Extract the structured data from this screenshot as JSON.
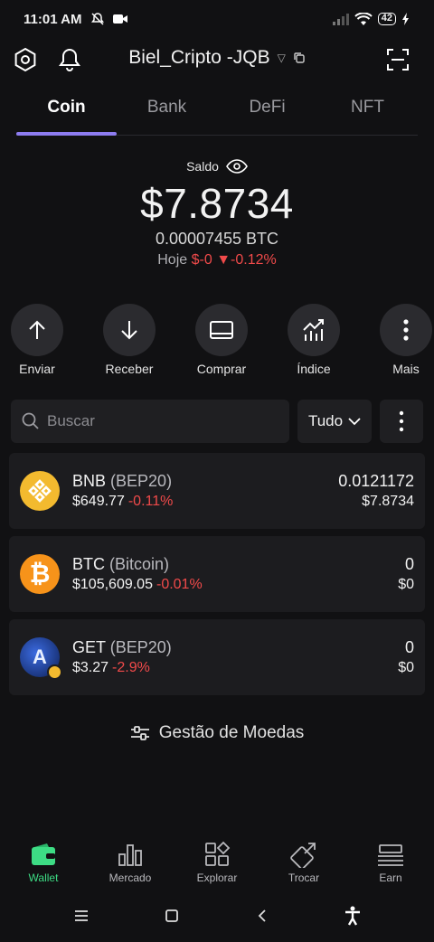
{
  "status_bar": {
    "time": "11:01 AM",
    "battery": "42"
  },
  "header": {
    "wallet_name": "Biel_Cripto -JQB"
  },
  "tabs": [
    {
      "label": "Coin",
      "active": true
    },
    {
      "label": "Bank",
      "active": false
    },
    {
      "label": "DeFi",
      "active": false
    },
    {
      "label": "NFT",
      "active": false
    }
  ],
  "balance": {
    "label": "Saldo",
    "value": "$7.8734",
    "btc": "0.00007455 BTC",
    "today_label": "Hoje",
    "today_change": "$-0",
    "today_percent": "-0.12%"
  },
  "actions": [
    {
      "label": "Enviar",
      "icon": "arrow-up-icon"
    },
    {
      "label": "Receber",
      "icon": "arrow-down-icon"
    },
    {
      "label": "Comprar",
      "icon": "card-icon"
    },
    {
      "label": "Índice",
      "icon": "chart-icon"
    },
    {
      "label": "Mais",
      "icon": "more-vertical-icon"
    }
  ],
  "search": {
    "placeholder": "Buscar",
    "filter_label": "Tudo"
  },
  "coins": [
    {
      "symbol": "BNB",
      "network": "(BEP20)",
      "price": "$649.77",
      "change": "-0.11%",
      "amount": "0.0121172",
      "fiat": "$7.8734",
      "color": "#F3BA2F"
    },
    {
      "symbol": "BTC",
      "network": "(Bitcoin)",
      "price": "$105,609.05",
      "change": "-0.01%",
      "amount": "0",
      "fiat": "$0",
      "color": "#F7931A"
    },
    {
      "symbol": "GET",
      "network": "(BEP20)",
      "price": "$3.27",
      "change": "-2.9%",
      "amount": "0",
      "fiat": "$0",
      "color": "#1b3a8f"
    }
  ],
  "manage_label": "Gestão de Moedas",
  "bottom_nav": [
    {
      "label": "Wallet",
      "active": true
    },
    {
      "label": "Mercado",
      "active": false
    },
    {
      "label": "Explorar",
      "active": false
    },
    {
      "label": "Trocar",
      "active": false
    },
    {
      "label": "Earn",
      "active": false
    }
  ],
  "colors": {
    "accent": "#8d7cf0",
    "negative": "#f04a4a",
    "wallet_active": "#3ddc84"
  }
}
